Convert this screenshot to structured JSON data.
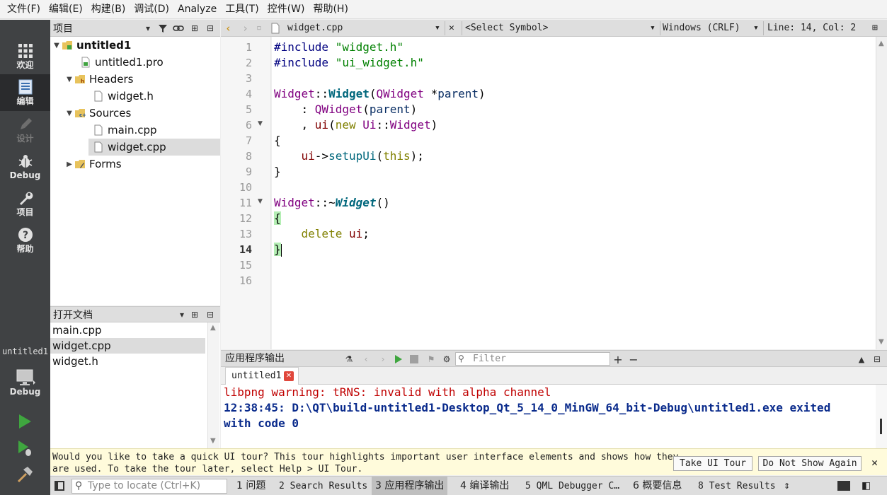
{
  "menu": [
    "文件(F)",
    "编辑(E)",
    "构建(B)",
    "调试(D)",
    "Analyze",
    "工具(T)",
    "控件(W)",
    "帮助(H)"
  ],
  "modes": [
    {
      "label": "欢迎",
      "icon": "grid-icon",
      "state": "normal"
    },
    {
      "label": "编辑",
      "icon": "document-icon",
      "state": "active"
    },
    {
      "label": "设计",
      "icon": "pencil-icon",
      "state": "disabled"
    },
    {
      "label": "Debug",
      "icon": "bug-icon",
      "state": "normal"
    },
    {
      "label": "项目",
      "icon": "wrench-icon",
      "state": "normal"
    },
    {
      "label": "帮助",
      "icon": "help-icon",
      "state": "normal"
    }
  ],
  "kit": {
    "project_name": "untitled1",
    "mode": "Debug"
  },
  "project_pane": {
    "title": "项目",
    "tree": [
      {
        "label": "untitled1",
        "level": 0,
        "expanded": true,
        "bold": true,
        "icon": "project-icon"
      },
      {
        "label": "untitled1.pro",
        "level": 1,
        "icon": "pro-file-icon"
      },
      {
        "label": "Headers",
        "level": 1,
        "expanded": true,
        "icon": "header-folder-icon"
      },
      {
        "label": "widget.h",
        "level": 2,
        "icon": "file-icon"
      },
      {
        "label": "Sources",
        "level": 1,
        "expanded": true,
        "icon": "source-folder-icon"
      },
      {
        "label": "main.cpp",
        "level": 2,
        "icon": "file-icon"
      },
      {
        "label": "widget.cpp",
        "level": 2,
        "icon": "file-icon",
        "selected": true
      },
      {
        "label": "Forms",
        "level": 1,
        "expanded": false,
        "icon": "forms-folder-icon"
      }
    ]
  },
  "open_docs": {
    "title": "打开文档",
    "items": [
      {
        "label": "main.cpp"
      },
      {
        "label": "widget.cpp",
        "selected": true
      },
      {
        "label": "widget.h"
      }
    ]
  },
  "editor_toolbar": {
    "file": "widget.cpp",
    "symbol": "<Select Symbol>",
    "line_ending": "Windows (CRLF)",
    "position": "Line: 14, Col: 2"
  },
  "editor": {
    "current_line": 14,
    "line_numbers": [
      "1",
      "2",
      "3",
      "4",
      "5",
      "6",
      "7",
      "8",
      "9",
      "10",
      "11",
      "12",
      "13",
      "14",
      "15",
      "16"
    ]
  },
  "output": {
    "title": "应用程序输出",
    "filter_placeholder": "Filter",
    "tab": "untitled1",
    "lines": [
      "libpng warning: tRNS: invalid with alpha channel",
      "12:38:45: D:\\QT\\build-untitled1-Desktop_Qt_5_14_0_MinGW_64_bit-Debug\\untitled1.exe exited",
      "with code 0"
    ]
  },
  "info_bar": {
    "line1": "Would you like to take a quick UI tour? This tour highlights important user interface elements and shows how they",
    "line2": "are used. To take the tour later, select Help > UI Tour.",
    "take_tour": "Take UI Tour",
    "dont_show": "Do Not Show Again"
  },
  "status_bar": {
    "locator_placeholder": "Type to locate (Ctrl+K)",
    "panes": [
      "1 问题",
      "2 Search Results",
      "3 应用程序输出",
      "4 编译输出",
      "5 QML Debugger C…",
      "6 概要信息",
      "8 Test Results"
    ],
    "active_pane": 2
  },
  "colors": {
    "mode_bar": "#404244",
    "mode_active": "#2a2b2d",
    "run_green": "#3fa63f",
    "preprocessor": "#000080",
    "string": "#008000",
    "type": "#800080",
    "keyword": "#808000",
    "info_bar_bg": "#fffbdb",
    "warning_text": "#c00000",
    "exit_text": "#0a2b8c"
  }
}
